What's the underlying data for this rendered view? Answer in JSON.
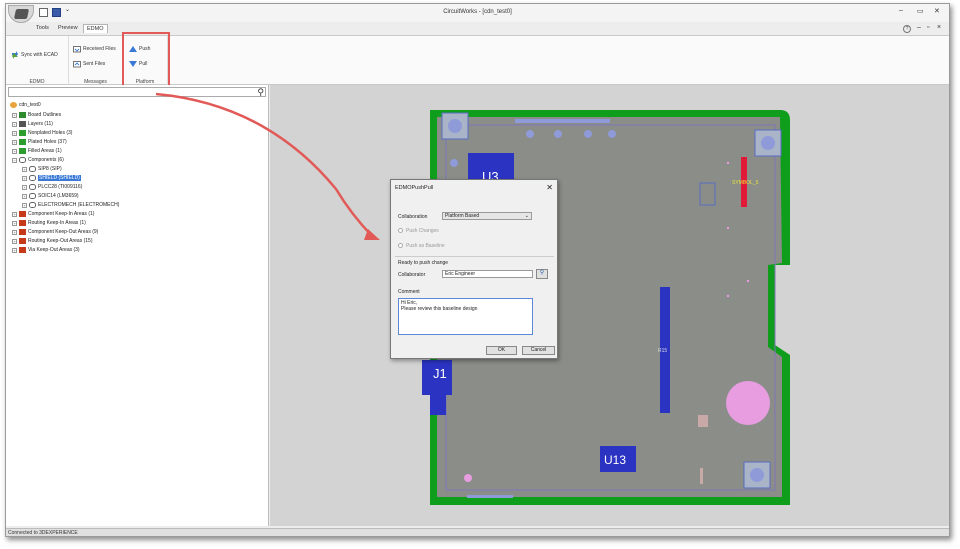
{
  "window": {
    "title": "CircuitWorks - [cdn_test0]",
    "min": "–",
    "restore": "▭",
    "close": "✕"
  },
  "tabs": [
    "Tools",
    "Preview",
    "EDMO"
  ],
  "doc_controls": {
    "help": "?",
    "min": "–",
    "restore": "▫",
    "close": "×"
  },
  "ribbon": {
    "groups": [
      {
        "label": "EDMO",
        "buttons": [
          "Sync with ECAD"
        ]
      },
      {
        "label": "Messages",
        "buttons": [
          "Received Files",
          "Sent Files"
        ]
      },
      {
        "label": "Platform",
        "buttons": [
          "Push",
          "Pull"
        ]
      }
    ]
  },
  "tree": {
    "root": "cdn_test0",
    "items": [
      "Board Outlines",
      "Layers (11)",
      "Nonplated Holes (3)",
      "Plated Holes (37)",
      "Filled Areas (1)",
      "Components (6)",
      "SIP8 (SIP)",
      "SHIELD (SHIELD)",
      "PLCC28 (TI009116)",
      "SOIC14 (LM3659)",
      "ELECTROMECH (ELECTROMECH)",
      "Component Keep-In Areas (1)",
      "Routing Keep-In Areas (1)",
      "Component Keep-Out Areas (9)",
      "Routing Keep-Out Areas (15)",
      "Via Keep-Out Areas (3)"
    ]
  },
  "status": "Connected to 3DEXPERIENCE",
  "board": {
    "labels": {
      "u3": "U3",
      "j1": "J1",
      "u13": "U13",
      "r15": "R15",
      "symbol": "SYMBOL_5"
    },
    "colors": {
      "board": "#848884",
      "outline": "#0f9d1c",
      "pad": "#2b33c2",
      "pink": "#e79de0",
      "red": "#e11a3a"
    }
  },
  "dialog": {
    "title": "EDMOPushPull",
    "close": "✕",
    "collaboration_label": "Collaboration",
    "collaboration_value": "Platform Based",
    "radio_push_changes": "Push Changes",
    "radio_push_baseline": "Push as Baseline",
    "section": "Ready to push change",
    "collaborator_label": "Collaborator",
    "collaborator_value": "Eric Engineer",
    "comment_label": "Comment",
    "comment_line1": "Hi Eric,",
    "comment_line2": "Please review this baseline design",
    "ok": "OK",
    "cancel": "Cancel"
  }
}
